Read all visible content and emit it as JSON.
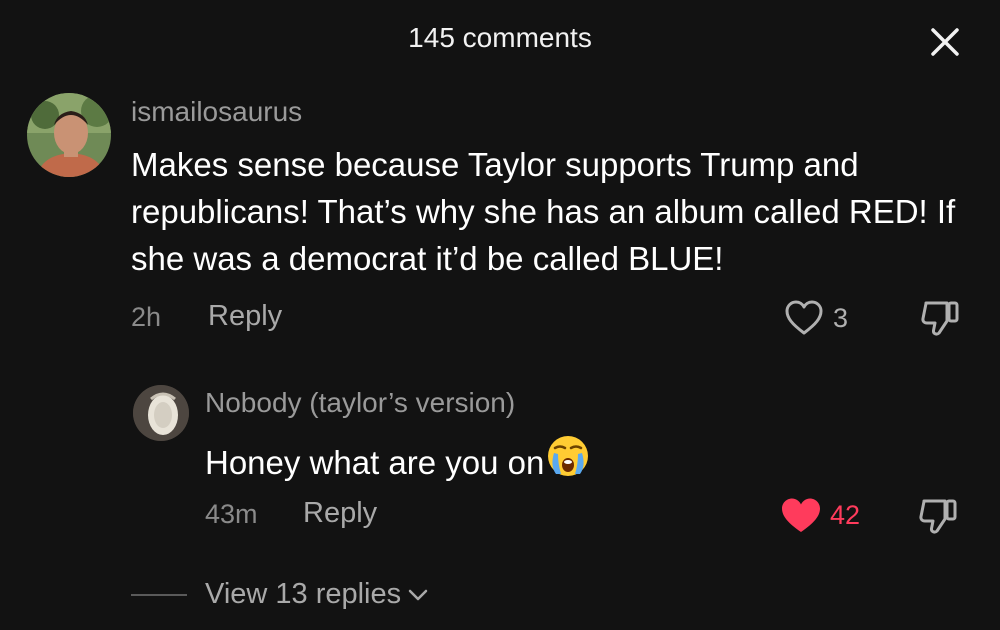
{
  "header": {
    "title": "145 comments"
  },
  "comments": [
    {
      "username": "ismailosaurus",
      "text": "Makes sense because Taylor supports Trump and republicans! That’s why she has an album called RED! If she was a democrat it’d be called BLUE!",
      "time": "2h",
      "reply_label": "Reply",
      "likes": "3",
      "liked": false
    },
    {
      "username": "Nobody (taylor’s version)",
      "text": "Honey what are you on",
      "emoji": "loudly-crying-face",
      "time": "43m",
      "reply_label": "Reply",
      "likes": "42",
      "liked": true
    }
  ],
  "view_replies": {
    "label": "View 13 replies"
  },
  "colors": {
    "background": "#121212",
    "liked": "#ff3b5c",
    "muted": "#9a9a9a"
  }
}
